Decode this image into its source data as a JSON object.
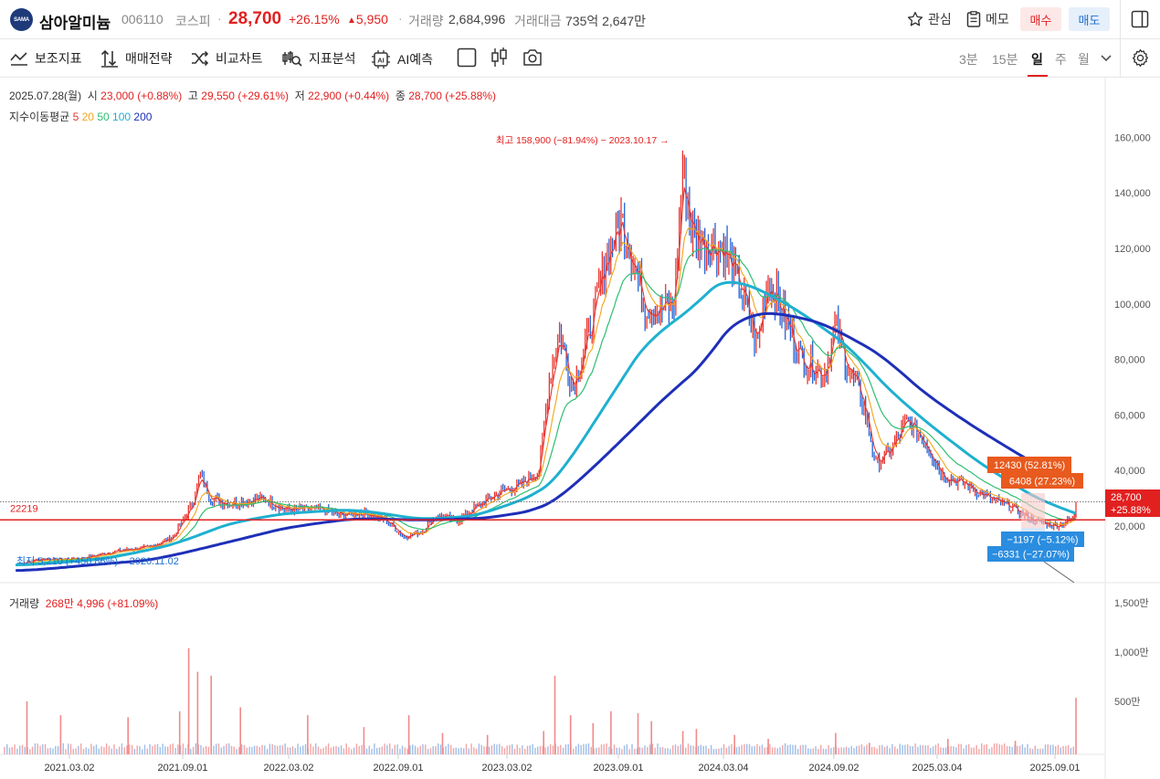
{
  "header": {
    "logo_text": "SAMA",
    "stock_name": "삼아알미늄",
    "stock_code": "006110",
    "market": "코스피",
    "price": "28,700",
    "change_pct": "+26.15%",
    "change_amt": "5,950",
    "volume_label": "거래량",
    "volume_value": "2,684,996",
    "amount_label": "거래대금",
    "amount_value": "735억 2,647만",
    "watch_label": "관심",
    "memo_label": "메모",
    "buy_label": "매수",
    "sell_label": "매도"
  },
  "toolbar": {
    "indicators": "보조지표",
    "strategy": "매매전략",
    "compare": "비교차트",
    "analysis": "지표분석",
    "ai": "AI예측",
    "timeframes": [
      "3분",
      "15분",
      "일",
      "주",
      "월"
    ],
    "active_timeframe": "일"
  },
  "info": {
    "date": "2025.07.28(월)",
    "open_label": "시",
    "open": "23,000 (+0.88%)",
    "high_label": "고",
    "high": "29,550 (+29.61%)",
    "low_label": "저",
    "low": "22,900 (+0.44%)",
    "close_label": "종",
    "close": "28,700 (+25.88%)"
  },
  "ma_legend": {
    "label": "지수이동평균",
    "periods": [
      "5",
      "20",
      "50",
      "100",
      "200"
    ],
    "colors": [
      "#e8352f",
      "#f2a51a",
      "#2fbf71",
      "#1fb0d0",
      "#1e2fb8"
    ]
  },
  "volume_info": {
    "label": "거래량",
    "value": "268만 4,996 (+81.09%)"
  },
  "chart_data": {
    "type": "line",
    "y_ticks": [
      "160,000",
      "140,000",
      "120,000",
      "100,000",
      "80,000",
      "60,000",
      "40,000",
      "20,000"
    ],
    "ylim": [
      0,
      175000
    ],
    "volume_ticks": [
      "1,500만",
      "1,000만",
      "500만"
    ],
    "x_ticks": [
      "2021.03.02",
      "2021.09.01",
      "2022.03.02",
      "2022.09.01",
      "2023.03.02",
      "2023.09.01",
      "2024.03.04",
      "2024.09.02",
      "2025.03.04",
      "2025.09.01"
    ],
    "annotations": {
      "high": "최고 158,900 (−81.94%) − 2023.10.17",
      "low": "최저 5,210 (+450.86%) − 2020.11.02",
      "ref_line_value": "22219",
      "current_price": "28,700",
      "current_pct": "+25.88%",
      "box1": "12430 (52.81%)",
      "box2": "6408 (27.23%)",
      "box3": "−1197 (−5.12%)",
      "box4": "−6331 (−27.07%)"
    },
    "series": [
      {
        "name": "5",
        "color": "#e8352f"
      },
      {
        "name": "20",
        "color": "#f2a51a"
      },
      {
        "name": "50",
        "color": "#2fbf71"
      },
      {
        "name": "100",
        "color": "#1fb0d0"
      },
      {
        "name": "200",
        "color": "#1e2fb8"
      }
    ],
    "price_path": [
      [
        2020.85,
        6000
      ],
      [
        2020.95,
        8000
      ],
      [
        2021.05,
        8000
      ],
      [
        2021.15,
        8500
      ],
      [
        2021.3,
        11000
      ],
      [
        2021.45,
        12500
      ],
      [
        2021.55,
        16000
      ],
      [
        2021.63,
        27000
      ],
      [
        2021.67,
        38000
      ],
      [
        2021.72,
        30000
      ],
      [
        2021.8,
        28000
      ],
      [
        2021.95,
        30000
      ],
      [
        2022.05,
        26000
      ],
      [
        2022.2,
        26000
      ],
      [
        2022.3,
        24000
      ],
      [
        2022.4,
        25000
      ],
      [
        2022.5,
        22000
      ],
      [
        2022.58,
        16000
      ],
      [
        2022.66,
        18000
      ],
      [
        2022.72,
        24000
      ],
      [
        2022.82,
        22000
      ],
      [
        2022.9,
        27000
      ],
      [
        2023.0,
        32000
      ],
      [
        2023.1,
        35000
      ],
      [
        2023.18,
        40000
      ],
      [
        2023.22,
        70000
      ],
      [
        2023.27,
        90000
      ],
      [
        2023.33,
        70000
      ],
      [
        2023.42,
        95000
      ],
      [
        2023.48,
        118000
      ],
      [
        2023.55,
        130000
      ],
      [
        2023.6,
        115000
      ],
      [
        2023.65,
        100000
      ],
      [
        2023.72,
        98000
      ],
      [
        2023.78,
        100000
      ],
      [
        2023.82,
        150000
      ],
      [
        2023.86,
        125000
      ],
      [
        2023.92,
        122000
      ],
      [
        2024.0,
        120000
      ],
      [
        2024.08,
        105000
      ],
      [
        2024.15,
        85000
      ],
      [
        2024.2,
        110000
      ],
      [
        2024.27,
        95000
      ],
      [
        2024.35,
        80000
      ],
      [
        2024.45,
        75000
      ],
      [
        2024.5,
        92000
      ],
      [
        2024.55,
        78000
      ],
      [
        2024.62,
        65000
      ],
      [
        2024.68,
        42000
      ],
      [
        2024.75,
        48000
      ],
      [
        2024.82,
        58000
      ],
      [
        2024.9,
        50000
      ],
      [
        2024.98,
        38000
      ],
      [
        2025.08,
        35000
      ],
      [
        2025.18,
        30000
      ],
      [
        2025.28,
        27000
      ],
      [
        2025.38,
        22000
      ],
      [
        2025.48,
        20000
      ],
      [
        2025.56,
        22800
      ],
      [
        2025.57,
        28700
      ]
    ],
    "ma200_path": [
      [
        2020.85,
        4000
      ],
      [
        2021.1,
        6000
      ],
      [
        2021.4,
        8000
      ],
      [
        2021.7,
        14000
      ],
      [
        2022.0,
        20000
      ],
      [
        2022.3,
        23000
      ],
      [
        2022.6,
        22000
      ],
      [
        2022.9,
        23000
      ],
      [
        2023.1,
        26000
      ],
      [
        2023.2,
        30000
      ],
      [
        2023.45,
        50000
      ],
      [
        2023.7,
        70000
      ],
      [
        2023.85,
        80000
      ],
      [
        2024.0,
        98000
      ],
      [
        2024.15,
        98000
      ],
      [
        2024.4,
        92000
      ],
      [
        2024.65,
        80000
      ],
      [
        2024.85,
        65000
      ],
      [
        2025.1,
        52000
      ],
      [
        2025.35,
        40000
      ],
      [
        2025.57,
        32000
      ]
    ],
    "ma100_path": [
      [
        2020.85,
        6000
      ],
      [
        2021.2,
        8500
      ],
      [
        2021.5,
        14000
      ],
      [
        2021.75,
        22000
      ],
      [
        2022.0,
        25000
      ],
      [
        2022.3,
        26000
      ],
      [
        2022.6,
        22000
      ],
      [
        2022.85,
        24000
      ],
      [
        2023.1,
        32000
      ],
      [
        2023.2,
        38000
      ],
      [
        2023.4,
        65000
      ],
      [
        2023.6,
        90000
      ],
      [
        2023.8,
        100000
      ],
      [
        2023.95,
        112000
      ],
      [
        2024.1,
        105000
      ],
      [
        2024.3,
        95000
      ],
      [
        2024.5,
        83000
      ],
      [
        2024.7,
        65000
      ],
      [
        2024.9,
        52000
      ],
      [
        2025.1,
        40000
      ],
      [
        2025.35,
        28000
      ],
      [
        2025.57,
        22000
      ]
    ],
    "volume_spikes": [
      [
        2020.9,
        250
      ],
      [
        2021.05,
        180
      ],
      [
        2021.35,
        170
      ],
      [
        2021.58,
        200
      ],
      [
        2021.62,
        520
      ],
      [
        2021.66,
        400
      ],
      [
        2021.72,
        380
      ],
      [
        2021.85,
        220
      ],
      [
        2022.15,
        180
      ],
      [
        2022.4,
        120
      ],
      [
        2022.6,
        180
      ],
      [
        2022.75,
        90
      ],
      [
        2022.95,
        80
      ],
      [
        2023.2,
        100
      ],
      [
        2023.25,
        380
      ],
      [
        2023.32,
        180
      ],
      [
        2023.42,
        140
      ],
      [
        2023.5,
        200
      ],
      [
        2023.62,
        190
      ],
      [
        2023.68,
        150
      ],
      [
        2023.82,
        100
      ],
      [
        2023.88,
        110
      ],
      [
        2024.05,
        80
      ],
      [
        2024.2,
        60
      ],
      [
        2024.5,
        90
      ],
      [
        2024.65,
        40
      ],
      [
        2025.0,
        60
      ],
      [
        2025.3,
        50
      ],
      [
        2025.57,
        268
      ]
    ]
  }
}
